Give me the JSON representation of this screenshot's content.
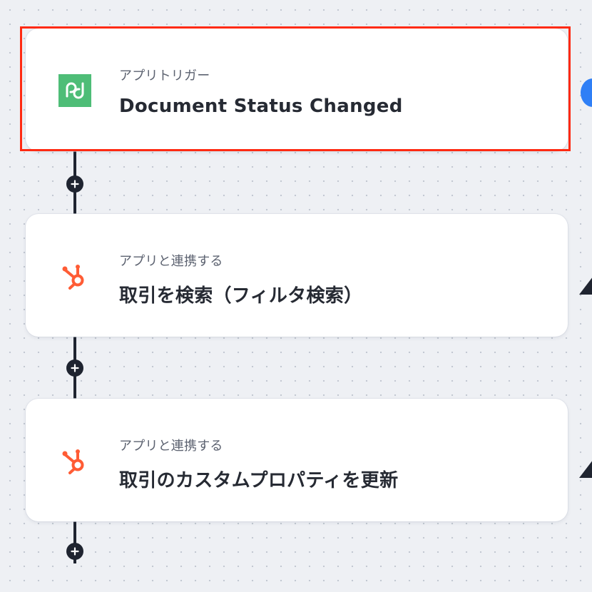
{
  "flow": {
    "steps": [
      {
        "app": "PandaDoc",
        "category": "アプリトリガー",
        "title": "Document Status Changed",
        "icon": "pandadoc-icon",
        "icon_color": "#4ebd77",
        "selected": true
      },
      {
        "app": "HubSpot",
        "category": "アプリと連携する",
        "title": "取引を検索（フィルタ検索）",
        "icon": "hubspot-icon",
        "icon_color": "#ff5c35",
        "selected": false
      },
      {
        "app": "HubSpot",
        "category": "アプリと連携する",
        "title": "取引のカスタムプロパティを更新",
        "icon": "hubspot-icon",
        "icon_color": "#ff5c35",
        "selected": false
      }
    ],
    "add_step_icon": "plus-icon",
    "selection_color": "#ff2a12",
    "connector_color": "#1f2430"
  }
}
